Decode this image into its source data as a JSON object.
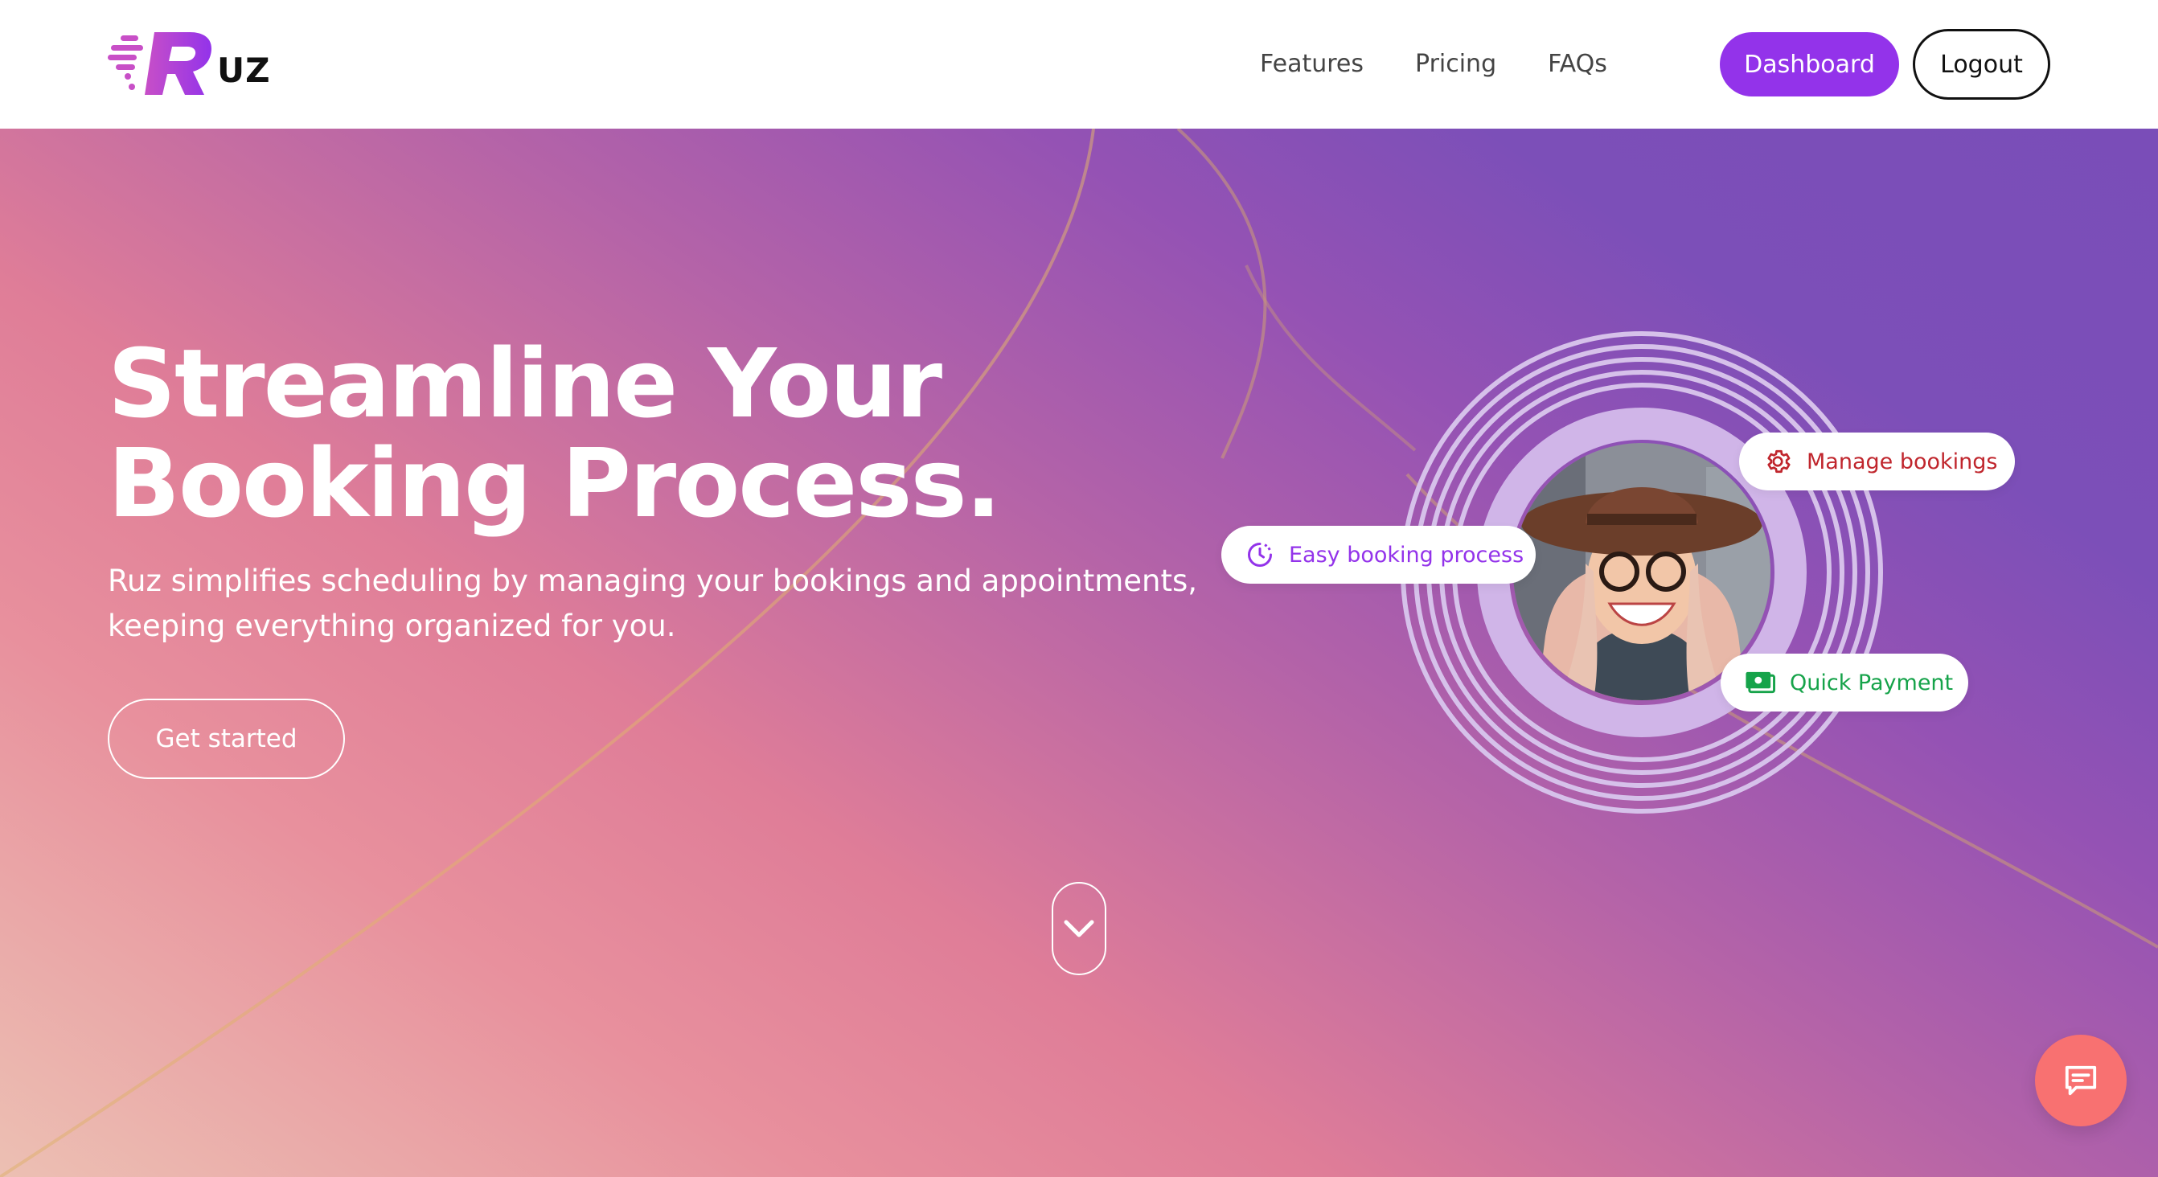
{
  "brand": {
    "logo_text": "UZ",
    "accent": "#9333ea"
  },
  "nav": {
    "links": [
      "Features",
      "Pricing",
      "FAQs"
    ],
    "dashboard_label": "Dashboard",
    "logout_label": "Logout"
  },
  "hero": {
    "title": "Streamline Your Booking Process.",
    "subtitle": "Ruz simplifies scheduling by managing your bookings and appointments, keeping everything organized for you.",
    "cta_label": "Get started",
    "scroll_icon": "chevron-down-icon"
  },
  "chips": {
    "manage": {
      "label": "Manage bookings",
      "icon": "gear-icon",
      "color": "#c0262d"
    },
    "easy": {
      "label": "Easy booking process",
      "icon": "clock-icon",
      "color": "#9333ea"
    },
    "payment": {
      "label": "Quick Payment",
      "icon": "money-icon",
      "color": "#16a34a"
    }
  },
  "chat": {
    "icon": "chat-icon",
    "color": "#f87171"
  }
}
